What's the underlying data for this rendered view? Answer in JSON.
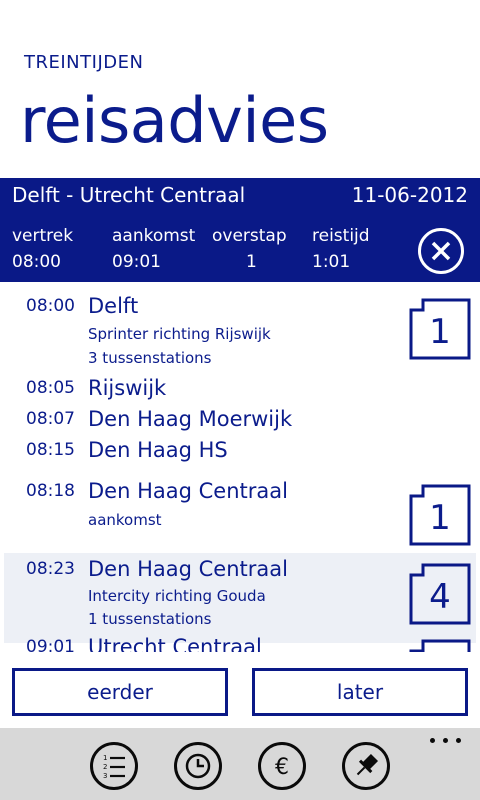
{
  "header": {
    "app_title": "TREINTIJDEN",
    "page_title": "reisadvies"
  },
  "route": {
    "name": "Delft - Utrecht Centraal",
    "date": "11-06-2012",
    "summary": {
      "vertrek_label": "vertrek",
      "vertrek_value": "08:00",
      "aankomst_label": "aankomst",
      "aankomst_value": "09:01",
      "overstap_label": "overstap",
      "overstap_value": "1",
      "reistijd_label": "reistijd",
      "reistijd_value": "1:01"
    }
  },
  "stops": [
    {
      "time": "08:00",
      "name": "Delft",
      "sub1": "Sprinter richting Rijswijk",
      "sub2": "3 tussenstations",
      "platform": "1"
    },
    {
      "time": "08:05",
      "name": "Rijswijk"
    },
    {
      "time": "08:07",
      "name": "Den Haag Moerwijk"
    },
    {
      "time": "08:15",
      "name": "Den Haag HS"
    },
    {
      "time": "08:18",
      "name": "Den Haag Centraal",
      "sub1": "aankomst",
      "platform": "1"
    },
    {
      "time": "08:23",
      "name": "Den Haag Centraal",
      "sub1": "Intercity richting Gouda",
      "sub2": "1 tussenstations",
      "platform": "4"
    },
    {
      "time": "09:01",
      "name": "Utrecht Centraal"
    }
  ],
  "buttons": {
    "earlier": "eerder",
    "later": "later"
  },
  "appbar": {
    "icons": [
      "list-icon",
      "clock-icon",
      "euro-icon",
      "pin-icon"
    ]
  },
  "colors": {
    "accent": "#0a1987",
    "text": "#0b1c8c",
    "highlight": "#edf0f6",
    "appbar": "#d8d8d8"
  }
}
